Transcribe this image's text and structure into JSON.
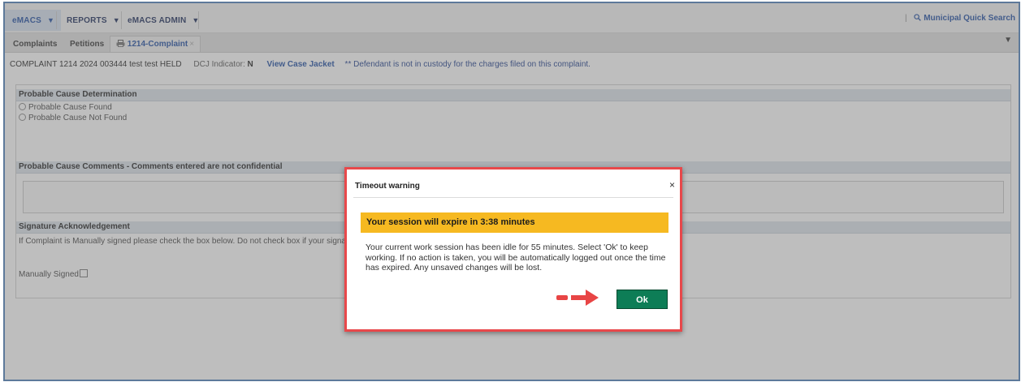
{
  "menubar": {
    "items": [
      {
        "label": "eMACS",
        "active": true
      },
      {
        "label": "REPORTS",
        "active": false
      },
      {
        "label": "eMACS ADMIN",
        "active": false
      }
    ],
    "arrow": "▼",
    "quick_search_label": "Municipal Quick Search",
    "quick_search_icon": "search-icon"
  },
  "tabs": {
    "items": [
      {
        "label": "Complaints"
      },
      {
        "label": "Petitions"
      }
    ],
    "active_tab": {
      "label": "1214-Complaint",
      "icon": "printer-icon"
    },
    "overflow_arrow": "▼"
  },
  "info": {
    "complaint": "COMPLAINT 1214 2024 003444 test test HELD",
    "dcj_label": "DCJ Indicator:",
    "dcj_value": "N",
    "case_jacket_link": "View Case Jacket",
    "notice": "** Defendant is not in custody for the charges filed on this complaint."
  },
  "sections": {
    "probable_cause": {
      "title": "Probable Cause Determination",
      "options": [
        "Probable Cause Found",
        "Probable Cause Not Found"
      ]
    },
    "comments": {
      "title": "Probable Cause Comments - Comments entered are not confidential"
    },
    "signature": {
      "title": "Signature Acknowledgement",
      "text": "If Complaint is Manually signed please check the box below. Do not check box if your signature is",
      "manual_label": "Manually Signed"
    }
  },
  "modal": {
    "title": "Timeout warning",
    "close": "×",
    "banner": "Your session will expire in 3:38 minutes",
    "message": "Your current work session has been idle for 55 minutes. Select 'Ok' to keep working. If no action is taken, you will be automatically logged out once the time has expired. Any unsaved changes will be lost.",
    "ok_label": "Ok",
    "annotation_icon": "red-arrow-icon"
  },
  "colors": {
    "frame_border": "#4f81bd",
    "modal_outline": "#e8484b",
    "banner_bg": "#f6b921",
    "ok_button": "#0d7d56"
  }
}
